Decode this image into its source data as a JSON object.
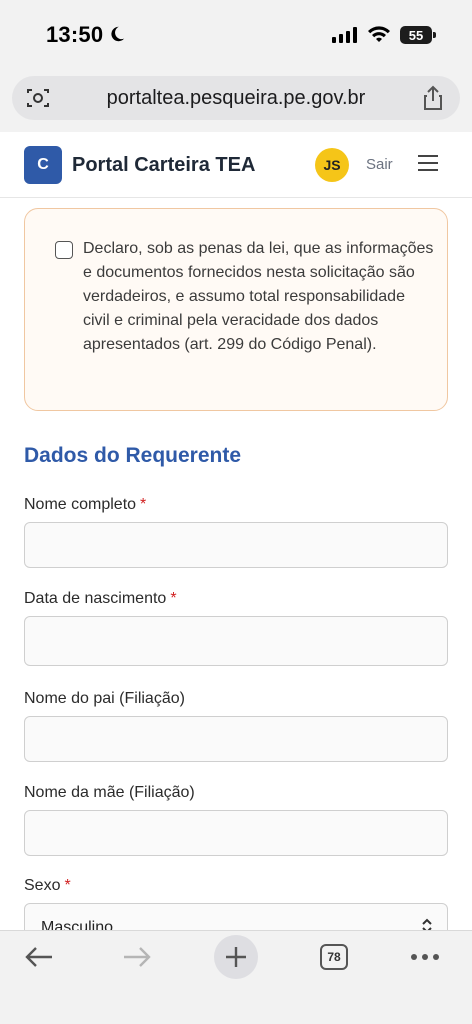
{
  "status_bar": {
    "time": "13:50",
    "battery": "55"
  },
  "browser": {
    "url": "portaltea.pesqueira.pe.gov.br",
    "tab_count": "78"
  },
  "header": {
    "logo_letter": "C",
    "title": "Portal Carteira TEA",
    "avatar_initials": "JS",
    "logout_label": "Sair"
  },
  "declaration": {
    "checked": false,
    "text": "Declaro, sob as penas da lei, que as informações e documentos fornecidos nesta solicitação são verdadeiros, e assumo total responsabilidade civil e criminal pela veracidade dos dados apresentados (art. 299 do Código Penal)."
  },
  "section": {
    "title": "Dados do Requerente"
  },
  "fields": {
    "nome_completo": {
      "label": "Nome completo",
      "required_mark": "*",
      "value": ""
    },
    "data_nascimento": {
      "label": "Data de nascimento",
      "required_mark": "*",
      "value": ""
    },
    "nome_pai": {
      "label": "Nome do pai (Filiação)",
      "value": ""
    },
    "nome_mae": {
      "label": "Nome da mãe (Filiação)",
      "value": ""
    },
    "sexo": {
      "label": "Sexo",
      "required_mark": "*",
      "selected": "Masculino"
    }
  },
  "colors": {
    "brand_blue": "#2f5aa8",
    "avatar_yellow": "#f5c518",
    "required_red": "#d11f1f",
    "card_border": "#f0c7a1"
  },
  "icons": [
    "moon-icon",
    "signal-icon",
    "wifi-icon",
    "camera-scan-icon",
    "share-icon",
    "menu-icon",
    "chevron-updown-icon",
    "back-arrow-icon",
    "forward-arrow-icon",
    "plus-icon",
    "tabs-icon",
    "more-icon"
  ]
}
